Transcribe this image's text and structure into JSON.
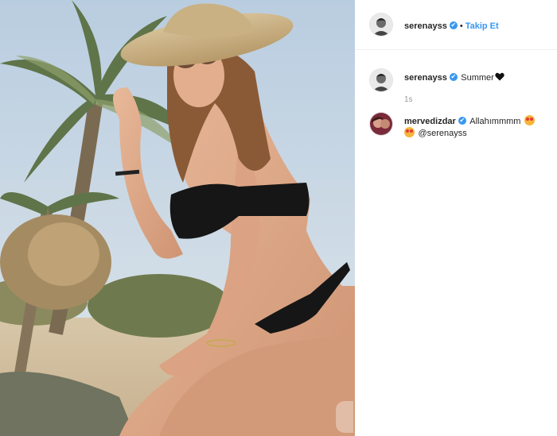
{
  "post": {
    "author": "serenayss",
    "follow_label": "Takip Et",
    "separator": "•",
    "verified_mark": "✔",
    "image_icon": "photo"
  },
  "caption": {
    "username": "serenayss",
    "text": "Summer",
    "emoji": "black-heart-icon",
    "time": "1s"
  },
  "comments": [
    {
      "username": "mervedizdar",
      "text": "Allahımmmm",
      "line2_mention": "@serenayss",
      "emojis": [
        "heart-eyes-icon",
        "heart-eyes-icon"
      ]
    }
  ],
  "colors": {
    "accent": "#3897f0",
    "text": "#262626",
    "muted": "#999999"
  }
}
